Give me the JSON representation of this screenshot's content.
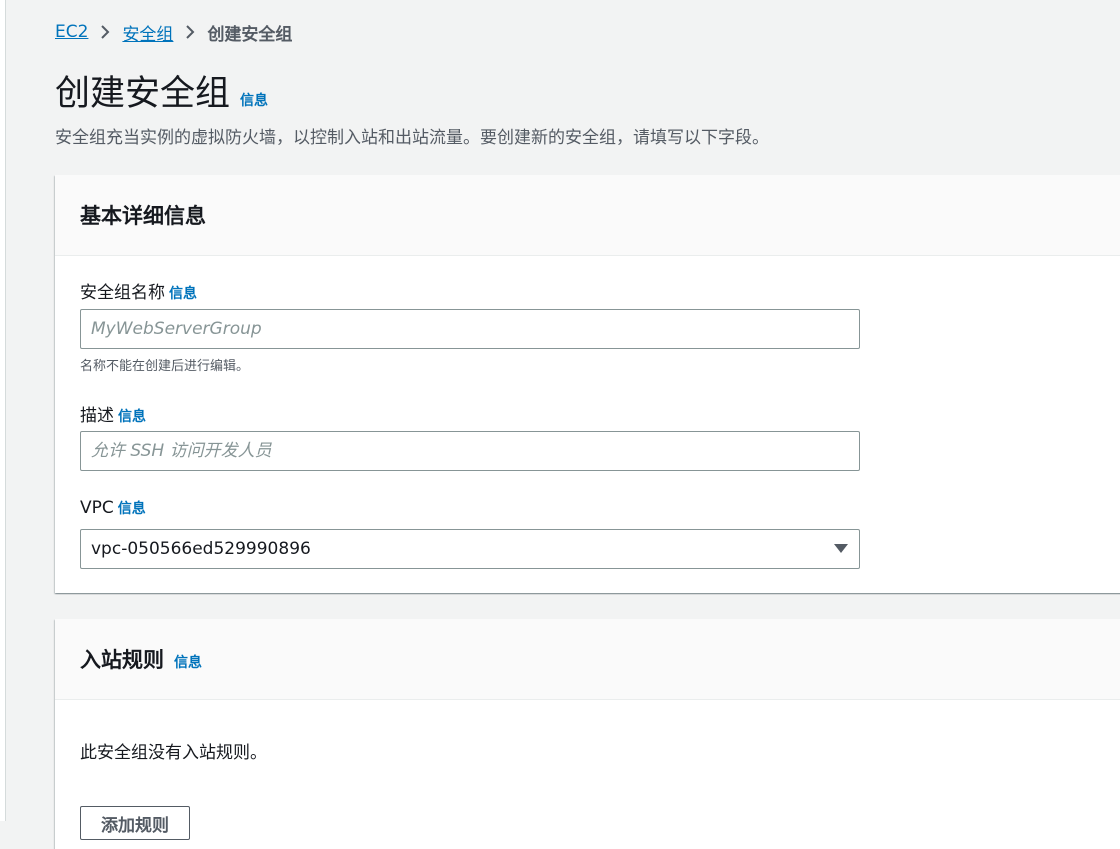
{
  "breadcrumb": {
    "items": [
      "EC2",
      "安全组"
    ],
    "current": "创建安全组"
  },
  "header": {
    "title": "创建安全组",
    "info": "信息",
    "description": "安全组充当实例的虚拟防火墙，以控制入站和出站流量。要创建新的安全组，请填写以下字段。"
  },
  "basic_details": {
    "title": "基本详细信息",
    "name_label": "安全组名称",
    "name_info": "信息",
    "name_placeholder": "MyWebServerGroup",
    "name_hint": "名称不能在创建后进行编辑。",
    "desc_label": "描述",
    "desc_info": "信息",
    "desc_placeholder": "允许 SSH 访问开发人员",
    "vpc_label": "VPC",
    "vpc_info": "信息",
    "vpc_value": "vpc-050566ed529990896"
  },
  "inbound_rules": {
    "title": "入站规则",
    "info": "信息",
    "empty_message": "此安全组没有入站规则。",
    "add_rule_label": "添加规则"
  },
  "colors": {
    "link": "#0073bb",
    "background": "#f2f3f3",
    "panel_header": "#fafafa",
    "text": "#16191f",
    "secondary_text": "#545b64"
  }
}
